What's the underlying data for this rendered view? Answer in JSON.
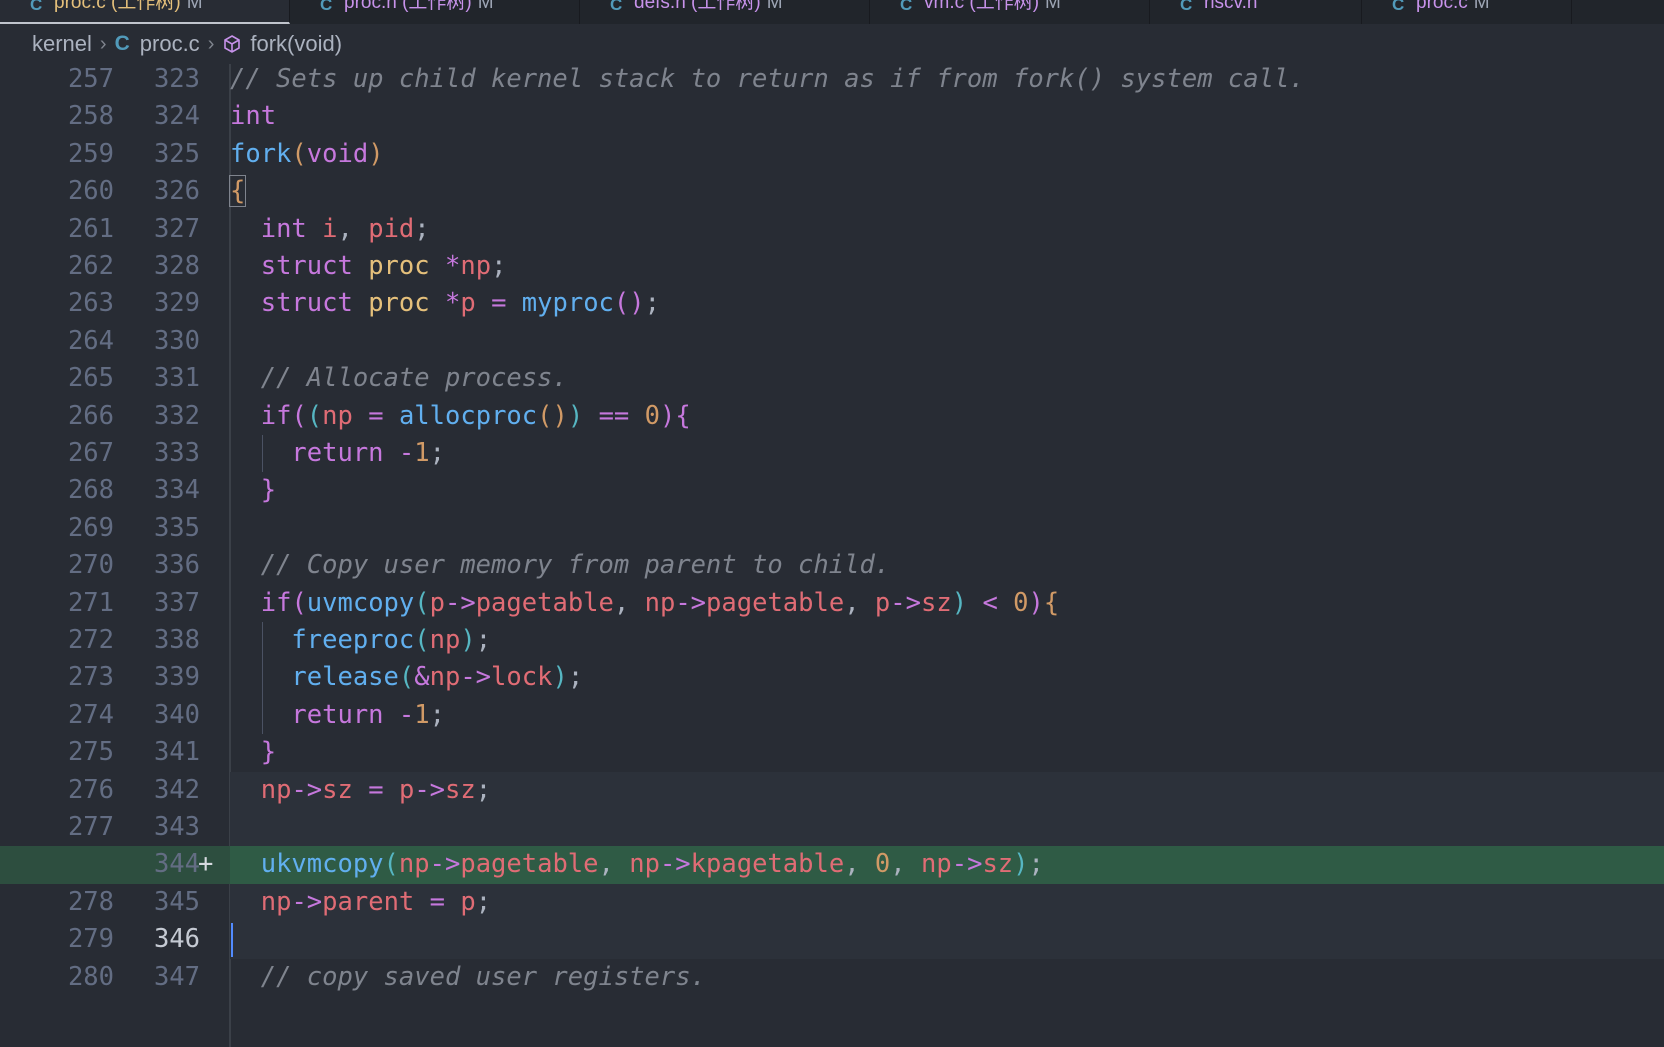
{
  "tabs": [
    {
      "label": "proc.c (工作树)",
      "dirty": "M",
      "active": true
    },
    {
      "label": "proc.h (工作树)",
      "dirty": "M",
      "active": false
    },
    {
      "label": "defs.h (工作树)",
      "dirty": "M",
      "active": false
    },
    {
      "label": "vm.c (工作树)",
      "dirty": "M",
      "active": false
    },
    {
      "label": "riscv.h",
      "dirty": "",
      "active": false
    },
    {
      "label": "proc.c",
      "dirty": "M",
      "active": false
    }
  ],
  "breadcrumb": {
    "folder": "kernel",
    "file": "proc.c",
    "symbol": "fork(void)"
  },
  "colors": {
    "background": "#282c34",
    "added_line": "#2f5b45",
    "keyword": "#c678dd",
    "function": "#61afef",
    "type": "#e5c07b",
    "variable": "#e06c75",
    "number": "#d19a66",
    "comment": "#7f848e"
  },
  "lines": [
    {
      "old": "257",
      "new": "323",
      "tokens": [
        [
          "cm",
          "// Sets up child kernel stack to return as if from fork() system call."
        ]
      ]
    },
    {
      "old": "258",
      "new": "324",
      "tokens": [
        [
          "kw",
          "int"
        ]
      ]
    },
    {
      "old": "259",
      "new": "325",
      "tokens": [
        [
          "fn",
          "fork"
        ],
        [
          "b1",
          "("
        ],
        [
          "kw",
          "void"
        ],
        [
          "b1",
          ")"
        ]
      ]
    },
    {
      "old": "260",
      "new": "326",
      "tokens": [
        [
          "b1",
          "{"
        ]
      ]
    },
    {
      "old": "261",
      "new": "327",
      "tokens": [
        [
          "pun",
          "  "
        ],
        [
          "kw",
          "int"
        ],
        [
          "pun",
          " "
        ],
        [
          "var",
          "i"
        ],
        [
          "pun",
          ", "
        ],
        [
          "var",
          "pid"
        ],
        [
          "pun",
          ";"
        ]
      ]
    },
    {
      "old": "262",
      "new": "328",
      "tokens": [
        [
          "pun",
          "  "
        ],
        [
          "kw",
          "struct"
        ],
        [
          "pun",
          " "
        ],
        [
          "ty",
          "proc"
        ],
        [
          "pun",
          " "
        ],
        [
          "op",
          "*"
        ],
        [
          "var",
          "np"
        ],
        [
          "pun",
          ";"
        ]
      ]
    },
    {
      "old": "263",
      "new": "329",
      "tokens": [
        [
          "pun",
          "  "
        ],
        [
          "kw",
          "struct"
        ],
        [
          "pun",
          " "
        ],
        [
          "ty",
          "proc"
        ],
        [
          "pun",
          " "
        ],
        [
          "op",
          "*"
        ],
        [
          "var",
          "p"
        ],
        [
          "pun",
          " "
        ],
        [
          "op",
          "="
        ],
        [
          "pun",
          " "
        ],
        [
          "fn",
          "myproc"
        ],
        [
          "b2",
          "()"
        ],
        [
          "pun",
          ";"
        ]
      ]
    },
    {
      "old": "264",
      "new": "330",
      "tokens": []
    },
    {
      "old": "265",
      "new": "331",
      "tokens": [
        [
          "pun",
          "  "
        ],
        [
          "cm",
          "// Allocate process."
        ]
      ]
    },
    {
      "old": "266",
      "new": "332",
      "tokens": [
        [
          "pun",
          "  "
        ],
        [
          "kw",
          "if"
        ],
        [
          "b2",
          "("
        ],
        [
          "b3",
          "("
        ],
        [
          "var",
          "np"
        ],
        [
          "pun",
          " "
        ],
        [
          "op",
          "="
        ],
        [
          "pun",
          " "
        ],
        [
          "fn",
          "allocproc"
        ],
        [
          "b1",
          "()"
        ],
        [
          "b3",
          ")"
        ],
        [
          "pun",
          " "
        ],
        [
          "op",
          "=="
        ],
        [
          "pun",
          " "
        ],
        [
          "num",
          "0"
        ],
        [
          "b2",
          ")"
        ],
        [
          "b2",
          "{"
        ]
      ]
    },
    {
      "old": "267",
      "new": "333",
      "tokens": [
        [
          "pun",
          "    "
        ],
        [
          "kw",
          "return"
        ],
        [
          "pun",
          " "
        ],
        [
          "op",
          "-"
        ],
        [
          "num",
          "1"
        ],
        [
          "pun",
          ";"
        ]
      ]
    },
    {
      "old": "268",
      "new": "334",
      "tokens": [
        [
          "pun",
          "  "
        ],
        [
          "b2",
          "}"
        ]
      ]
    },
    {
      "old": "269",
      "new": "335",
      "tokens": []
    },
    {
      "old": "270",
      "new": "336",
      "tokens": [
        [
          "pun",
          "  "
        ],
        [
          "cm",
          "// Copy user memory from parent to child."
        ]
      ]
    },
    {
      "old": "271",
      "new": "337",
      "tokens": [
        [
          "pun",
          "  "
        ],
        [
          "kw",
          "if"
        ],
        [
          "b2",
          "("
        ],
        [
          "fn",
          "uvmcopy"
        ],
        [
          "b3",
          "("
        ],
        [
          "var",
          "p"
        ],
        [
          "op",
          "->"
        ],
        [
          "mem",
          "pagetable"
        ],
        [
          "pun",
          ", "
        ],
        [
          "var",
          "np"
        ],
        [
          "op",
          "->"
        ],
        [
          "mem",
          "pagetable"
        ],
        [
          "pun",
          ", "
        ],
        [
          "var",
          "p"
        ],
        [
          "op",
          "->"
        ],
        [
          "mem",
          "sz"
        ],
        [
          "b3",
          ")"
        ],
        [
          "pun",
          " "
        ],
        [
          "op",
          "<"
        ],
        [
          "pun",
          " "
        ],
        [
          "num",
          "0"
        ],
        [
          "b2",
          ")"
        ],
        [
          "b1",
          "{"
        ]
      ]
    },
    {
      "old": "272",
      "new": "338",
      "tokens": [
        [
          "pun",
          "    "
        ],
        [
          "fn",
          "freeproc"
        ],
        [
          "b3",
          "("
        ],
        [
          "var",
          "np"
        ],
        [
          "b3",
          ")"
        ],
        [
          "pun",
          ";"
        ]
      ]
    },
    {
      "old": "273",
      "new": "339",
      "tokens": [
        [
          "pun",
          "    "
        ],
        [
          "fn",
          "release"
        ],
        [
          "b3",
          "("
        ],
        [
          "op",
          "&"
        ],
        [
          "var",
          "np"
        ],
        [
          "op",
          "->"
        ],
        [
          "mem",
          "lock"
        ],
        [
          "b3",
          ")"
        ],
        [
          "pun",
          ";"
        ]
      ]
    },
    {
      "old": "274",
      "new": "340",
      "tokens": [
        [
          "pun",
          "    "
        ],
        [
          "kw",
          "return"
        ],
        [
          "pun",
          " "
        ],
        [
          "op",
          "-"
        ],
        [
          "num",
          "1"
        ],
        [
          "pun",
          ";"
        ]
      ]
    },
    {
      "old": "275",
      "new": "341",
      "tokens": [
        [
          "pun",
          "  "
        ],
        [
          "b2",
          "}"
        ]
      ]
    },
    {
      "old": "276",
      "new": "342",
      "tokens": [
        [
          "pun",
          "  "
        ],
        [
          "var",
          "np"
        ],
        [
          "op",
          "->"
        ],
        [
          "mem",
          "sz"
        ],
        [
          "pun",
          " "
        ],
        [
          "op",
          "="
        ],
        [
          "pun",
          " "
        ],
        [
          "var",
          "p"
        ],
        [
          "op",
          "->"
        ],
        [
          "mem",
          "sz"
        ],
        [
          "pun",
          ";"
        ]
      ]
    },
    {
      "old": "277",
      "new": "343",
      "tokens": []
    },
    {
      "old": "",
      "new": "344",
      "added": true,
      "marker": "+",
      "tokens": [
        [
          "pun",
          "  "
        ],
        [
          "fn",
          "ukvmcopy"
        ],
        [
          "b3",
          "("
        ],
        [
          "var",
          "np"
        ],
        [
          "op",
          "->"
        ],
        [
          "mem",
          "pagetable"
        ],
        [
          "pun",
          ", "
        ],
        [
          "var",
          "np"
        ],
        [
          "op",
          "->"
        ],
        [
          "mem",
          "kpagetable"
        ],
        [
          "pun",
          ", "
        ],
        [
          "num",
          "0"
        ],
        [
          "pun",
          ", "
        ],
        [
          "var",
          "np"
        ],
        [
          "op",
          "->"
        ],
        [
          "mem",
          "sz"
        ],
        [
          "b3",
          ")"
        ],
        [
          "pun",
          ";"
        ]
      ]
    },
    {
      "old": "278",
      "new": "345",
      "tokens": [
        [
          "pun",
          "  "
        ],
        [
          "var",
          "np"
        ],
        [
          "op",
          "->"
        ],
        [
          "mem",
          "parent"
        ],
        [
          "pun",
          " "
        ],
        [
          "op",
          "="
        ],
        [
          "pun",
          " "
        ],
        [
          "var",
          "p"
        ],
        [
          "pun",
          ";"
        ]
      ]
    },
    {
      "old": "279",
      "new": "346",
      "current": true,
      "tokens": []
    },
    {
      "old": "280",
      "new": "347",
      "tokens": [
        [
          "pun",
          "  "
        ],
        [
          "cm",
          "// copy saved user registers."
        ]
      ]
    }
  ]
}
